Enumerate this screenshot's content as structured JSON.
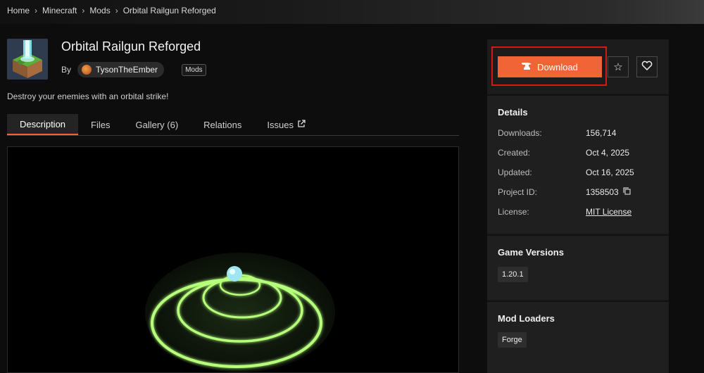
{
  "breadcrumb": [
    "Home",
    "Minecraft",
    "Mods",
    "Orbital Railgun Reforged"
  ],
  "project": {
    "title": "Orbital Railgun Reforged",
    "by_label": "By",
    "author": "TysonTheEmber",
    "tag": "Mods",
    "summary": "Destroy your enemies with an orbital strike!"
  },
  "tabs": [
    {
      "label": "Description",
      "active": true
    },
    {
      "label": "Files"
    },
    {
      "label": "Gallery (6)"
    },
    {
      "label": "Relations"
    },
    {
      "label": "Issues",
      "external": true
    }
  ],
  "actions": {
    "download_label": "Download",
    "accent": "#f16436",
    "highlight": "#d11b1b"
  },
  "details": {
    "heading": "Details",
    "rows": [
      {
        "key": "Downloads:",
        "value": "156,714"
      },
      {
        "key": "Created:",
        "value": "Oct 4, 2025"
      },
      {
        "key": "Updated:",
        "value": "Oct 16, 2025"
      },
      {
        "key": "Project ID:",
        "value": "1358503"
      },
      {
        "key": "License:",
        "value": "MIT License"
      }
    ]
  },
  "game_versions": {
    "heading": "Game Versions",
    "items": [
      "1.20.1"
    ]
  },
  "mod_loaders": {
    "heading": "Mod Loaders",
    "items": [
      "Forge"
    ]
  }
}
